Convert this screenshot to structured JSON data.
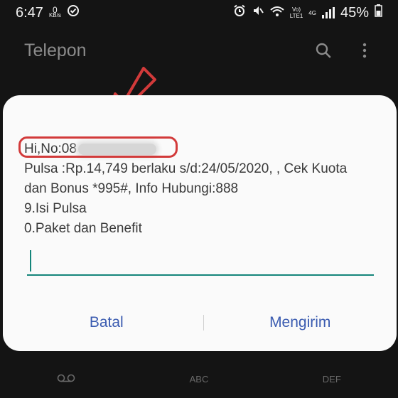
{
  "status_bar": {
    "time": "6:47",
    "speed_value": "0",
    "speed_unit": "KB/s",
    "network_top": "Vo)",
    "network_bottom": "LTE1",
    "network_type": "4G",
    "battery": "45%"
  },
  "app_bar": {
    "title": "Telepon",
    "search_icon": "search-icon",
    "more_icon": "more-vert-icon"
  },
  "dialog": {
    "greeting_prefix": "Hi,No:08",
    "lines": [
      "Pulsa :Rp.14,749 berlaku s/d:24/05/2020, , Cek Kuota",
      "dan Bonus *995#, Info Hubungi:888",
      "9.Isi Pulsa",
      "0.Paket dan Benefit"
    ],
    "input_value": "",
    "cancel_label": "Batal",
    "send_label": "Mengirim"
  },
  "keypad_hints": [
    "ABC",
    "DEF"
  ],
  "colors": {
    "background": "#141414",
    "dialog": "#fafafa",
    "accent_teal": "#14857a",
    "button_blue": "#3a5bb0",
    "annotation_red": "#d23a3a"
  }
}
